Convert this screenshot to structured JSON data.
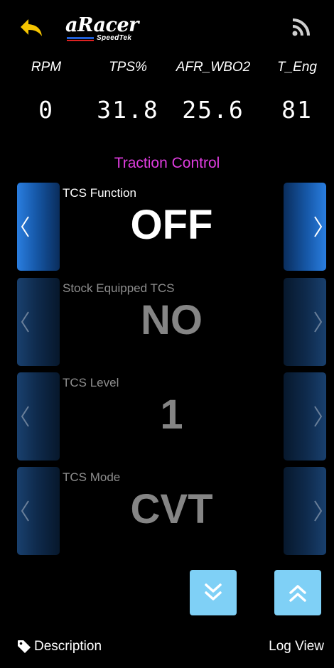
{
  "header": {
    "logo_text": "aRacer",
    "logo_subtext": "SpeedTek",
    "back_icon": "back-arrow-icon",
    "feed_icon": "rss-feed-icon",
    "accent_color": "#f5c400"
  },
  "metrics": [
    {
      "label": "RPM",
      "value": "0"
    },
    {
      "label": "TPS%",
      "value": "31.8"
    },
    {
      "label": "AFR_WBO2",
      "value": "25.6"
    },
    {
      "label": "T_Eng",
      "value": "81"
    }
  ],
  "section": {
    "title": "Traction Control",
    "title_color": "#e03de0"
  },
  "settings": [
    {
      "label": "TCS Function",
      "value": "OFF",
      "state": "active"
    },
    {
      "label": "Stock Equipped TCS",
      "value": "NO",
      "state": "inactive"
    },
    {
      "label": "TCS Level",
      "value": "1",
      "state": "inactive"
    },
    {
      "label": "TCS Mode",
      "value": "CVT",
      "state": "inactive"
    }
  ],
  "controls": {
    "scroll_down_icon": "double-chevron-down-icon",
    "scroll_up_icon": "double-chevron-up-icon",
    "button_color": "#7fd0f6"
  },
  "footer": {
    "description_label": "Description",
    "description_icon": "tag-icon",
    "log_view_label": "Log View"
  }
}
